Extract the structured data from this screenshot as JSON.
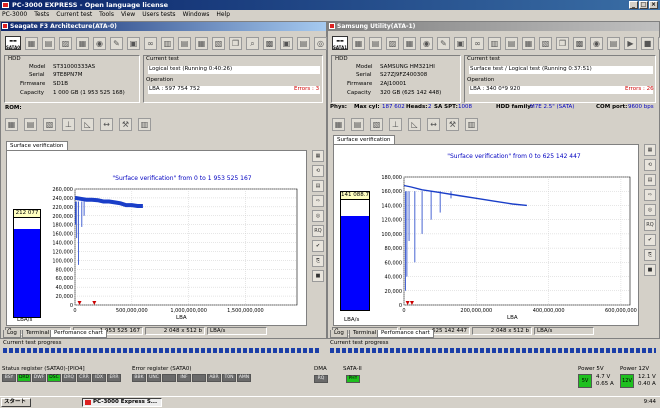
{
  "app": {
    "title": "PC-3000 EXPRESS - Open language license",
    "menu": [
      "PC-3000",
      "Tests",
      "Current test",
      "Tools",
      "View",
      "Users tests",
      "Windows",
      "Help"
    ]
  },
  "left": {
    "title": "Seagate F3 Architecture(ATA-0)",
    "sata_label": "SATA0",
    "hdd": {
      "group": "HDD",
      "model_label": "Model",
      "model": "ST31000333AS",
      "serial_label": "Serial",
      "serial": "9TE8PN7M",
      "firmware_label": "Firmware",
      "firmware": "SD1B",
      "capacity_label": "Capacity",
      "capacity": "1 000 GB (1 953 525 168)"
    },
    "current_test": {
      "group": "Current test",
      "name": "Logical test (Running 0:40:26)"
    },
    "operation": {
      "group": "Operation",
      "lba": "LBA : 597 754 752",
      "errors": "Errors : 3"
    },
    "rom_label": "ROM:",
    "tab": "Surface verification",
    "chart_title": "\"Surface verification\" from 0 to 1 953 525 167",
    "speed_box": "212 077",
    "speed_axis": "LBA/s",
    "x_axis_label": "LBA",
    "status": [
      "0",
      "1 953 525 167",
      "2 048 x 512 b",
      "LBA/s"
    ],
    "bottom_tabs": [
      "Log",
      "Terminal",
      "Perfomance chart"
    ]
  },
  "right": {
    "title": "Samsung Utility(ATA-1)",
    "sata_label": "SATA1",
    "hdd": {
      "group": "HDD",
      "model_label": "Model",
      "model": "SAMSUNG HM321HI",
      "serial_label": "Serial",
      "serial": "S27ZJ9FZ400308",
      "firmware_label": "Firmware",
      "firmware": "2AJ10001",
      "capacity_label": "Capacity",
      "capacity": "320 GB (625 142 448)"
    },
    "current_test": {
      "group": "Current test",
      "name": "Surface test / Logical test (Running 0:37:51)"
    },
    "operation": {
      "group": "Operation",
      "lba": "LBA : 340 0*9 920",
      "errors": "Errors : 26"
    },
    "phys": {
      "phys": "Phys:",
      "max_cyl_label": "Max cyl:",
      "max_cyl": "187 602",
      "heads_label": "Heads:",
      "heads": "2",
      "sa_spt_label": "SA SPT:",
      "sa_spt": "1008",
      "family_label": "HDD family:",
      "family": "M7E 2.5\" (SATA)",
      "com_label": "COM port:",
      "com": "9600 bps"
    },
    "tab": "Surface verification",
    "chart_title": "\"Surface verification\" from 0 to 625 142 447",
    "speed_box": "141 088.7",
    "speed_axis": "LBA/s",
    "x_axis_label": "LBA",
    "status": [
      "0",
      "625 142 447",
      "2 048 x 512 b",
      "LBA/s"
    ],
    "bottom_tabs": [
      "Log",
      "Terminal",
      "Perfomance chart"
    ]
  },
  "progress_label": "Current test progress",
  "status_register": {
    "label": "Status register (SATA0)-[PIO4]",
    "leds": [
      "BSY",
      "DRD",
      "DWF",
      "DSC",
      "DRQ",
      "CRR",
      "IDX",
      "ERR"
    ],
    "on": [
      false,
      true,
      false,
      true,
      false,
      false,
      false,
      false
    ]
  },
  "error_register": {
    "label": "Error register (SATA0)",
    "leds": [
      "BBK",
      "UNC",
      "",
      "INF",
      "",
      "ABR",
      "T0N",
      "AMN"
    ]
  },
  "dma": {
    "label": "DMA",
    "leds": [
      "RQ"
    ]
  },
  "sata2": {
    "label": "SATA-II",
    "leds": [
      "PHY"
    ],
    "on": [
      true
    ]
  },
  "power5": {
    "label": "Power 5V",
    "v": "4.7 V",
    "a": "0.65 A",
    "btn": "5V"
  },
  "power12": {
    "label": "Power 12V",
    "v": "12.1 V",
    "a": "0.40 A",
    "btn": "12V"
  },
  "taskbar": {
    "start": "スタート",
    "task": "PC-3000 Express S...",
    "clock": "9:44"
  },
  "chart_data": [
    {
      "type": "line",
      "title": "\"Surface verification\" from 0 to 1 953 525 167",
      "xlabel": "LBA",
      "ylabel": "",
      "xlim": [
        0,
        1953525167
      ],
      "ylim": [
        0,
        260000
      ],
      "x_ticks": [
        "0",
        "500,000,000",
        "1,000,000,000",
        "1,500,000,000"
      ],
      "y_ticks": [
        "0",
        "20,000",
        "40,000",
        "60,000",
        "80,000",
        "100,000",
        "120,000",
        "140,000",
        "160,000",
        "180,000",
        "200,000",
        "220,000",
        "240,000",
        "260,000"
      ],
      "series": [
        {
          "values_x": [
            0,
            50000000,
            100000000,
            150000000,
            200000000,
            250000000,
            300000000,
            350000000,
            400000000,
            450000000,
            500000000,
            550000000,
            597754752
          ],
          "values_y": [
            240000,
            238000,
            236000,
            236000,
            235000,
            232000,
            232000,
            230000,
            228000,
            224000,
            224000,
            222000,
            222000
          ]
        }
      ],
      "dips_x": [
        5000000,
        15000000,
        30000000,
        60000000,
        80000000
      ],
      "dips_y": [
        180000,
        150000,
        90000,
        175000,
        200000
      ],
      "error_markers_x": [
        40000000,
        170000000
      ]
    },
    {
      "type": "line",
      "title": "\"Surface verification\" from 0 to 625 142 447",
      "xlabel": "LBA",
      "ylabel": "",
      "xlim": [
        0,
        625142447
      ],
      "ylim": [
        0,
        180000
      ],
      "x_ticks": [
        "0",
        "200,000,000",
        "400,000,000",
        "600,000,000"
      ],
      "y_ticks": [
        "0",
        "20,000",
        "40,000",
        "60,000",
        "80,000",
        "100,000",
        "120,000",
        "140,000",
        "160,000",
        "180,000"
      ],
      "series": [
        {
          "values_x": [
            0,
            20000000,
            50000000,
            100000000,
            150000000,
            200000000,
            250000000,
            300000000,
            340009920
          ],
          "values_y": [
            168000,
            166000,
            162000,
            158000,
            154000,
            150000,
            146000,
            142000,
            140000
          ]
        }
      ],
      "dips_x": [
        4000000,
        8000000,
        14000000,
        30000000,
        50000000,
        75000000,
        100000000,
        130000000
      ],
      "dips_y": [
        20000,
        40000,
        90000,
        60000,
        100000,
        120000,
        130000,
        150000
      ],
      "error_markers_x": [
        10000000,
        22000000
      ]
    }
  ]
}
